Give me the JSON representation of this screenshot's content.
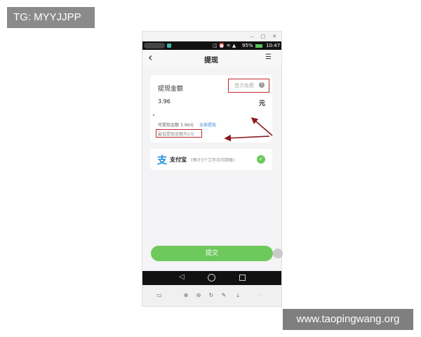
{
  "corner_tag": "TG: MYYJJPP",
  "watermark": "www.taopingwang.org",
  "window_controls": {
    "minimize": "‒",
    "maximize": "□",
    "close": "✕"
  },
  "status_bar": {
    "time": "10:47",
    "battery": "95%"
  },
  "header": {
    "title": "提现",
    "back_icon": "‹",
    "menu_icon": "☰"
  },
  "amount_card": {
    "label": "提现金额",
    "hint": "首次免费",
    "value": "3.96",
    "unit": "元",
    "available_text": "可提现金额 3.96元",
    "withdraw_all": "全部提现",
    "minimum_text": "最低提现金额为1元"
  },
  "payment": {
    "logo": "支",
    "name": "支付宝",
    "note": "(预计3个工作日内到账)",
    "selected": true
  },
  "submit_label": "提交",
  "colors": {
    "accent_green": "#6ec95d",
    "annotation_red": "#c0282e",
    "link_blue": "#3a8ad6"
  }
}
